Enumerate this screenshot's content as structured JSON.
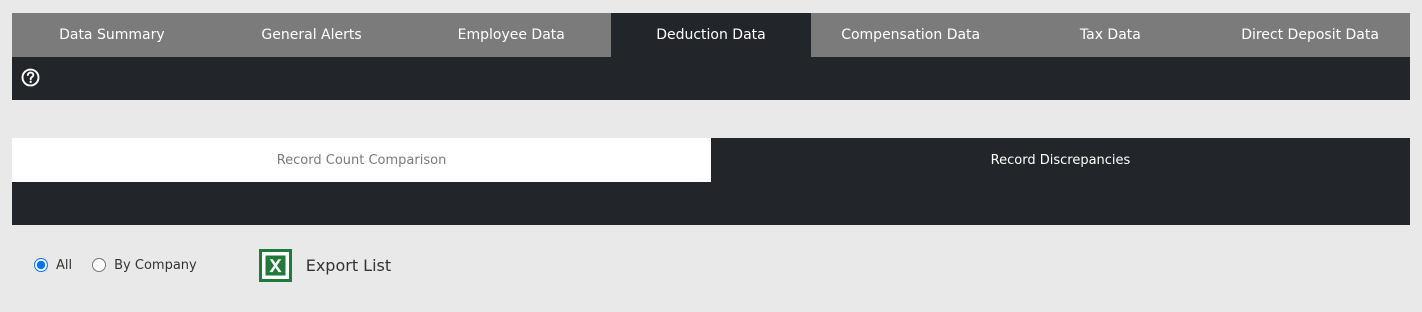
{
  "tabs": [
    {
      "label": "Data Summary"
    },
    {
      "label": "General Alerts"
    },
    {
      "label": "Employee Data"
    },
    {
      "label": "Deduction Data"
    },
    {
      "label": "Compensation Data"
    },
    {
      "label": "Tax Data"
    },
    {
      "label": "Direct Deposit Data"
    }
  ],
  "active_tab": "Deduction Data",
  "help": {
    "icon": "help-icon"
  },
  "sub_tabs": [
    {
      "label": "Record Count Comparison"
    },
    {
      "label": "Record Discrepancies"
    }
  ],
  "active_sub_tab": "Record Discrepancies",
  "filters": {
    "options": [
      {
        "label": "All",
        "checked": true
      },
      {
        "label": "By Company",
        "checked": false
      }
    ]
  },
  "export": {
    "label": "Export List",
    "icon": "excel-icon"
  },
  "colors": {
    "page_background": "#e9e9e9",
    "tab_bar": "#7b7b7b",
    "dark": "#22252a",
    "excel_green": "#1f7a3b"
  }
}
